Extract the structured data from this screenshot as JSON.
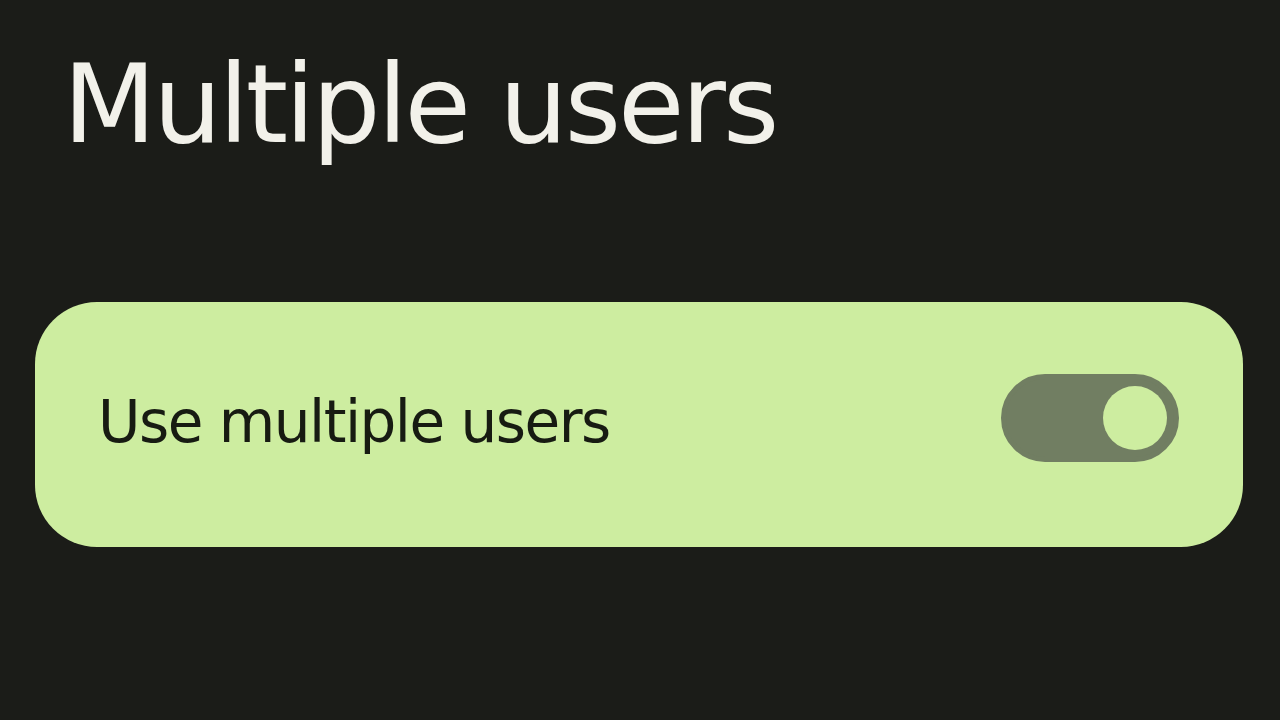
{
  "title": "Multiple users",
  "settings": [
    {
      "label": "Use multiple users",
      "kind": "switch",
      "on": true
    }
  ]
}
